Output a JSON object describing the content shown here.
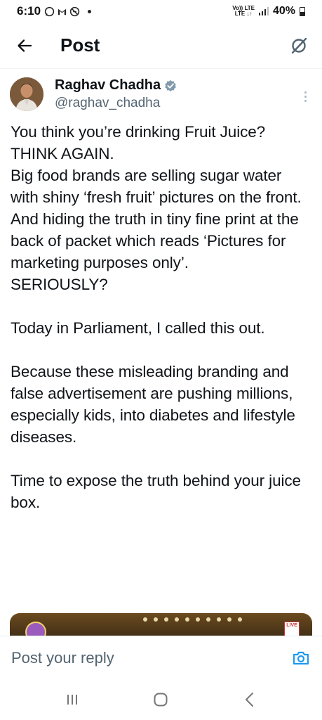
{
  "status_bar": {
    "time": "6:10",
    "network_top": "Vo)) LTE",
    "network_bottom": "LTE ↓↑",
    "battery": "40%"
  },
  "header": {
    "title": "Post"
  },
  "tweet": {
    "author_name": "Raghav Chadha",
    "handle": "@raghav_chadha",
    "paragraphs": [
      "You think you’re drinking Fruit Juice? THINK AGAIN.\nBig food brands are selling sugar water with shiny ‘fresh fruit’ pictures on the front. And hiding the truth in tiny fine print at the back of packet which reads ‘Pictures for marketing purposes only’.\nSERIOUSLY?",
      "Today in Parliament, I called this out.",
      "Because these misleading branding and false advertisement are pushing millions, especially kids, into diabetes and lifestyle diseases.",
      "Time to expose the truth behind your juice box."
    ]
  },
  "media": {
    "live_badge": "LIVE"
  },
  "reply": {
    "placeholder": "Post your reply"
  },
  "colors": {
    "text": "#0f1419",
    "secondary": "#536471",
    "accent": "#1d9bf0",
    "verified": "#829aab"
  },
  "icons": {
    "back": "arrow-left-icon",
    "grok": "grok-icon",
    "verified": "verified-badge-icon",
    "more": "more-vertical-icon",
    "camera": "camera-icon",
    "nav_recents": "recent-apps-icon",
    "nav_home": "home-icon",
    "nav_back": "back-chevron-icon"
  }
}
